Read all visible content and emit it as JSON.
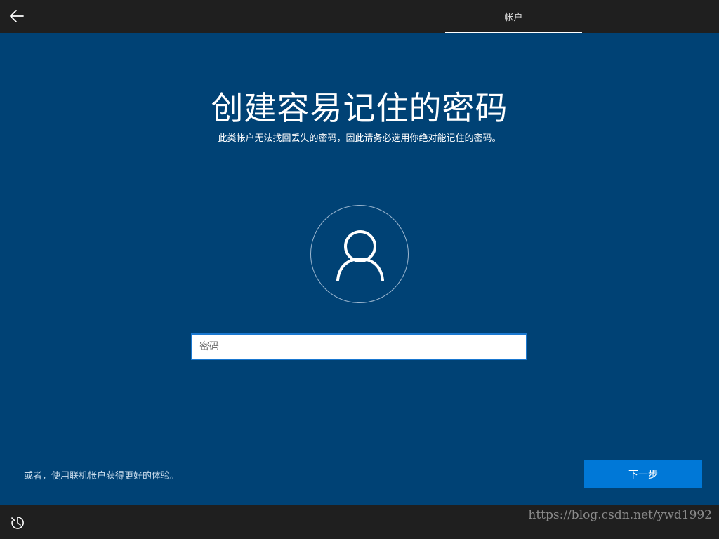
{
  "header": {
    "back_icon": "arrow-left-icon",
    "tab_label": "帐户"
  },
  "main": {
    "title": "创建容易记住的密码",
    "subtitle": "此类帐户无法找回丢失的密码，因此请务必选用你绝对能记住的密码。",
    "avatar_icon": "user-icon",
    "password_input": {
      "value": "",
      "placeholder": "密码"
    }
  },
  "footer": {
    "alt_link": "或者，使用联机帐户获得更好的体验。",
    "next_button": "下一步",
    "accessibility_icon": "ease-of-access-icon",
    "watermark": "https://blog.csdn.net/ywd1992"
  },
  "colors": {
    "background": "#004275",
    "bar": "#1f1f1f",
    "accent": "#0078d7"
  }
}
